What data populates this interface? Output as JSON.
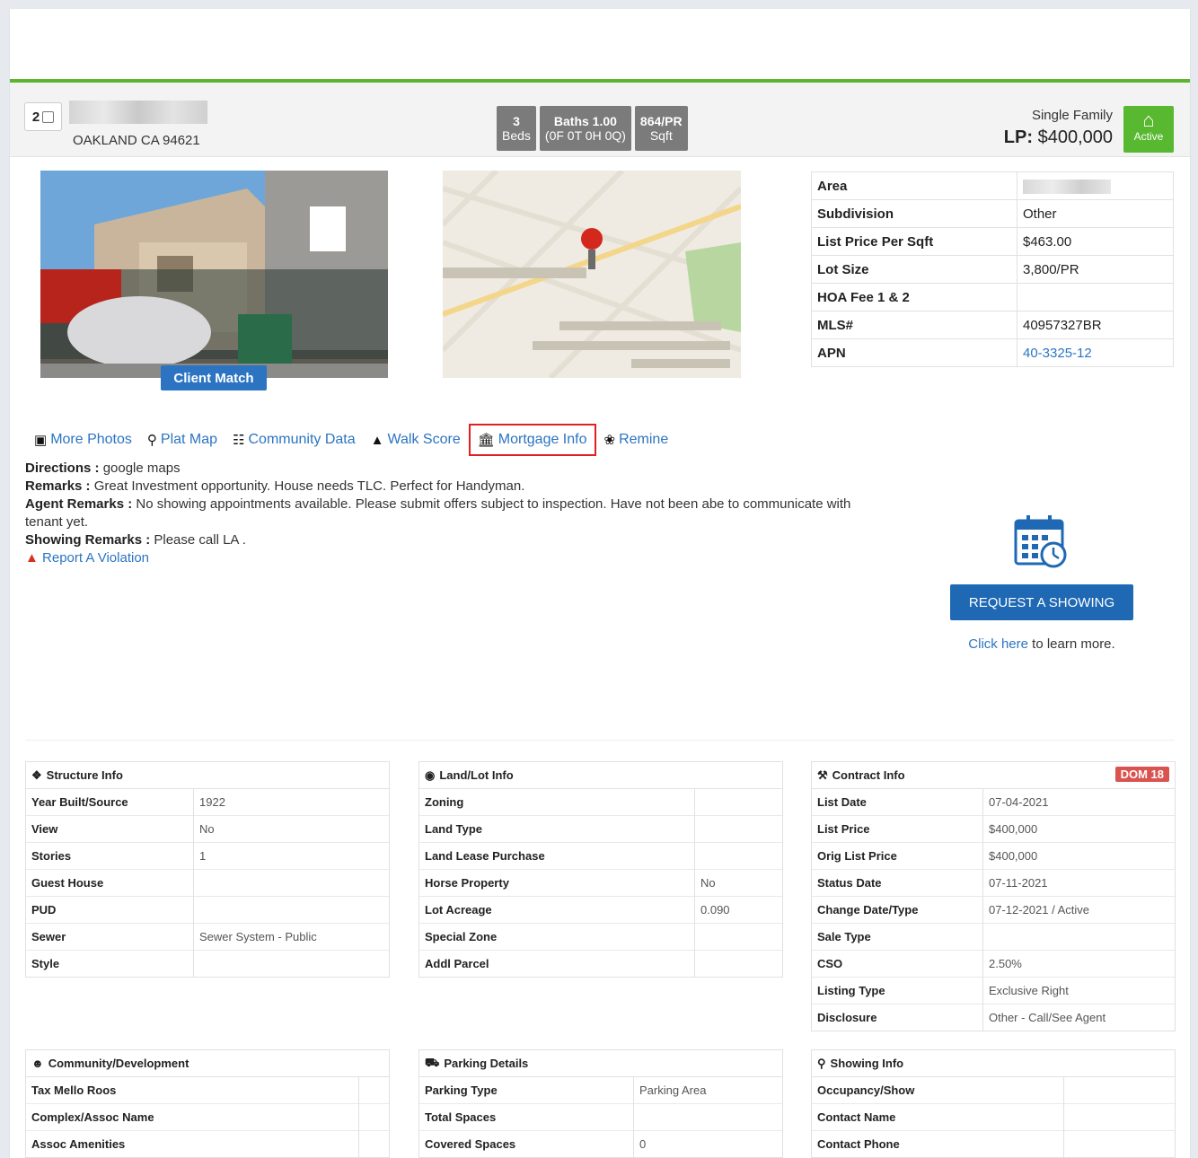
{
  "header": {
    "select_count": "2",
    "city": "OAKLAND CA 94621",
    "beds_count": "3",
    "beds_label": "Beds",
    "baths_value": "Baths 1.00",
    "baths_detail": "(0F 0T 0H 0Q)",
    "sqft_value": "864/PR",
    "sqft_label": "Sqft",
    "property_type": "Single Family",
    "lp_label": "LP:",
    "lp_value": "$400,000",
    "status": "Active",
    "status_color": "#58b82f"
  },
  "photo": {
    "badge": "Client Match"
  },
  "summary": [
    {
      "label": "Area",
      "value": ""
    },
    {
      "label": "Subdivision",
      "value": "Other"
    },
    {
      "label": "List Price Per Sqft",
      "value": "$463.00"
    },
    {
      "label": "Lot Size",
      "value": "3,800/PR"
    },
    {
      "label": "HOA Fee 1 & 2",
      "value": ""
    },
    {
      "label": "MLS#",
      "value": "40957327BR"
    },
    {
      "label": "APN",
      "value": "40-3325-12"
    }
  ],
  "links": {
    "more_photos": "More Photos",
    "plat_map": "Plat Map",
    "community_data": "Community Data",
    "walk_score": "Walk Score",
    "mortgage_info": "Mortgage Info",
    "remine": "Remine"
  },
  "remarks": {
    "directions_label": "Directions :",
    "directions": "google maps",
    "remarks_label": "Remarks :",
    "remarks": "Great Investment opportunity. House needs TLC. Perfect for Handyman.",
    "agent_label": "Agent Remarks :",
    "agent": "No showing appointments available. Please submit offers subject to inspection. Have not been abe to communicate with tenant yet.",
    "showing_label": "Showing Remarks :",
    "showing": "Please call LA .",
    "violation": "Report A Violation"
  },
  "showing": {
    "button": "REQUEST A SHOWING",
    "click_here": "Click here",
    "learn_more": " to learn more."
  },
  "structure": {
    "title": "Structure Info",
    "rows": [
      {
        "k": "Year Built/Source",
        "v": "1922"
      },
      {
        "k": "View",
        "v": "No"
      },
      {
        "k": "Stories",
        "v": "1"
      },
      {
        "k": "Guest House",
        "v": ""
      },
      {
        "k": "PUD",
        "v": ""
      },
      {
        "k": "Sewer",
        "v": "Sewer System - Public"
      },
      {
        "k": "Style",
        "v": ""
      }
    ]
  },
  "land": {
    "title": "Land/Lot Info",
    "rows": [
      {
        "k": "Zoning",
        "v": ""
      },
      {
        "k": "Land Type",
        "v": ""
      },
      {
        "k": "Land Lease Purchase",
        "v": ""
      },
      {
        "k": "Horse Property",
        "v": "No"
      },
      {
        "k": "Lot Acreage",
        "v": "0.090"
      },
      {
        "k": "Special Zone",
        "v": ""
      },
      {
        "k": "Addl Parcel",
        "v": ""
      }
    ]
  },
  "contract": {
    "title": "Contract Info",
    "dom": "DOM 18",
    "rows": [
      {
        "k": "List Date",
        "v": "07-04-2021"
      },
      {
        "k": "List Price",
        "v": "$400,000"
      },
      {
        "k": "Orig List Price",
        "v": "$400,000"
      },
      {
        "k": "Status Date",
        "v": "07-11-2021"
      },
      {
        "k": "Change Date/Type",
        "v": "07-12-2021 / Active"
      },
      {
        "k": "Sale Type",
        "v": ""
      },
      {
        "k": "CSO",
        "v": "2.50%"
      },
      {
        "k": "Listing Type",
        "v": "Exclusive Right"
      },
      {
        "k": "Disclosure",
        "v": "Other - Call/See Agent"
      }
    ]
  },
  "community": {
    "title": "Community/Development",
    "rows": [
      {
        "k": "Tax Mello Roos",
        "v": ""
      },
      {
        "k": "Complex/Assoc Name",
        "v": ""
      },
      {
        "k": "Assoc Amenities",
        "v": ""
      }
    ]
  },
  "parking": {
    "title": "Parking Details",
    "rows": [
      {
        "k": "Parking Type",
        "v": "Parking Area"
      },
      {
        "k": "Total Spaces",
        "v": ""
      },
      {
        "k": "Covered Spaces",
        "v": "0"
      }
    ]
  },
  "showing_info": {
    "title": "Showing Info",
    "rows": [
      {
        "k": "Occupancy/Show",
        "v": ""
      },
      {
        "k": "Contact Name",
        "v": ""
      },
      {
        "k": "Contact Phone",
        "v": ""
      }
    ]
  }
}
